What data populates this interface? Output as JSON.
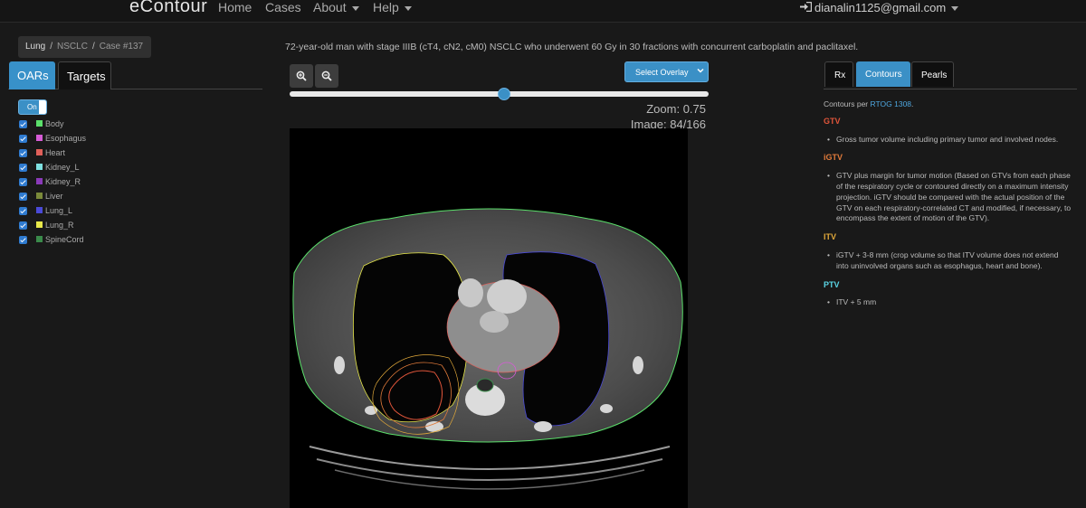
{
  "nav": {
    "brand": "eContour",
    "items": [
      {
        "label": "Home",
        "dropdown": false
      },
      {
        "label": "Cases",
        "dropdown": false
      },
      {
        "label": "About",
        "dropdown": true
      },
      {
        "label": "Help",
        "dropdown": true
      }
    ],
    "user": "dianalin1125@gmail.com",
    "user_icon": "sign-in-icon"
  },
  "breadcrumb": [
    "Lung",
    "NSCLC",
    "Case #137"
  ],
  "left_tabs": [
    "OARs",
    "Targets"
  ],
  "toggle": {
    "label": "On",
    "state": "on"
  },
  "oars": [
    {
      "name": "Body",
      "color": "#5be06b",
      "checked": true
    },
    {
      "name": "Esophagus",
      "color": "#d65cd6",
      "checked": true
    },
    {
      "name": "Heart",
      "color": "#e0605a",
      "checked": true
    },
    {
      "name": "Kidney_L",
      "color": "#7ee0e0",
      "checked": true
    },
    {
      "name": "Kidney_R",
      "color": "#8a3ab9",
      "checked": true
    },
    {
      "name": "Liver",
      "color": "#7b8a3a",
      "checked": true
    },
    {
      "name": "Lung_L",
      "color": "#4a4ad8",
      "checked": true
    },
    {
      "name": "Lung_R",
      "color": "#e8e84a",
      "checked": true
    },
    {
      "name": "SpineCord",
      "color": "#3a8a4a",
      "checked": true
    }
  ],
  "case_description": "72-year-old man with stage IIIB (cT4, cN2, cM0) NSCLC who underwent 60 Gy in 30 fractions with concurrent carboplatin and paclitaxel.",
  "viewer": {
    "overlay_button": "Select Overlay",
    "zoom_label": "Zoom: 0.75",
    "image_label": "Image: 84/166",
    "slider_value": 0.5,
    "zoom_in_icon": "zoom-in-icon",
    "zoom_out_icon": "zoom-out-icon"
  },
  "right_tabs": [
    "Rx",
    "Contours",
    "Pearls"
  ],
  "contours": {
    "intro_prefix": "Contours per ",
    "intro_link": "RTOG 1308",
    "intro_suffix": ".",
    "sections": [
      {
        "title": "GTV",
        "color": "#e0553a",
        "items": [
          "Gross tumor volume including primary tumor and involved nodes."
        ]
      },
      {
        "title": "iGTV",
        "color": "#e07a3a",
        "items": [
          "GTV plus margin for tumor motion (Based on GTVs from each phase of the respiratory cycle or contoured directly on a maximum intensity projection. iGTV should be compared with the actual position of the GTV on each respiratory-correlated CT and modified, if necessary, to encompass the extent of motion of the GTV)."
        ]
      },
      {
        "title": "ITV",
        "color": "#e0a83a",
        "items": [
          "iGTV + 3-8 mm (crop volume so that ITV volume does not extend into uninvolved organs such as esophagus, heart and bone)."
        ]
      },
      {
        "title": "PTV",
        "color": "#5ad6e6",
        "items": [
          "ITV + 5 mm"
        ]
      }
    ]
  }
}
